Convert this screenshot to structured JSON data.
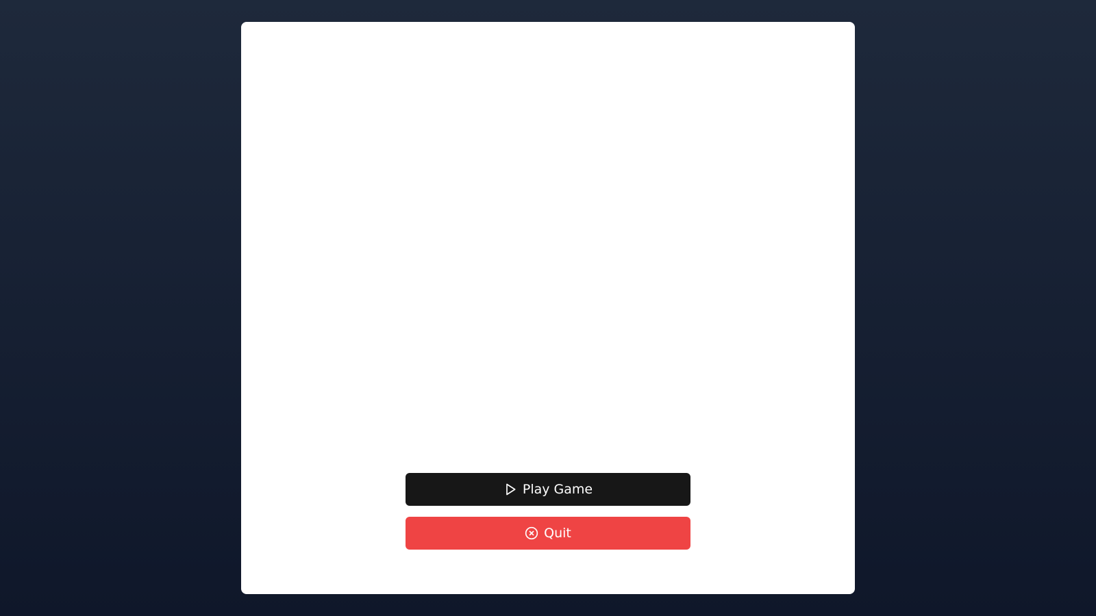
{
  "menu": {
    "play_label": "Play Game",
    "play_icon": "play-icon",
    "quit_label": "Quit",
    "quit_icon": "x-circle-icon"
  },
  "colors": {
    "background_top": "#1e293b",
    "background_bottom": "#0f172a",
    "card": "#ffffff",
    "play_button": "#171717",
    "quit_button": "#ef4444",
    "button_text": "#ffffff"
  }
}
